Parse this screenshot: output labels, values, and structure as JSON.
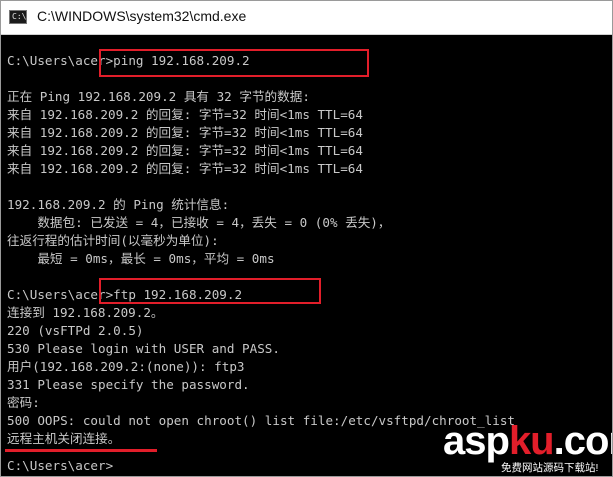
{
  "window": {
    "title": "C:\\WINDOWS\\system32\\cmd.exe",
    "icon_label": "C:\\"
  },
  "console": {
    "lines": [
      "C:\\Users\\acer>ping 192.168.209.2",
      "",
      "正在 Ping 192.168.209.2 具有 32 字节的数据:",
      "来自 192.168.209.2 的回复: 字节=32 时间<1ms TTL=64",
      "来自 192.168.209.2 的回复: 字节=32 时间<1ms TTL=64",
      "来自 192.168.209.2 的回复: 字节=32 时间<1ms TTL=64",
      "来自 192.168.209.2 的回复: 字节=32 时间<1ms TTL=64",
      "",
      "192.168.209.2 的 Ping 统计信息:",
      "    数据包: 已发送 = 4，已接收 = 4，丢失 = 0 (0% 丢失)，",
      "往返行程的估计时间(以毫秒为单位):",
      "    最短 = 0ms，最长 = 0ms，平均 = 0ms",
      "",
      "C:\\Users\\acer>ftp 192.168.209.2",
      "连接到 192.168.209.2。",
      "220 (vsFTPd 2.0.5)",
      "530 Please login with USER and PASS.",
      "用户(192.168.209.2:(none)): ftp3",
      "331 Please specify the password.",
      "密码:",
      "500 OOPS: could not open chroot() list file:/etc/vsftpd/chroot_list",
      "远程主机关闭连接。",
      "",
      "C:\\Users\\acer>"
    ]
  },
  "annotation_color": "#e21e2a",
  "watermark": {
    "brand_main": "asp",
    "brand_accent": "ku",
    "brand_suffix": ".com",
    "subtitle": "免费网站源码下载站!"
  }
}
